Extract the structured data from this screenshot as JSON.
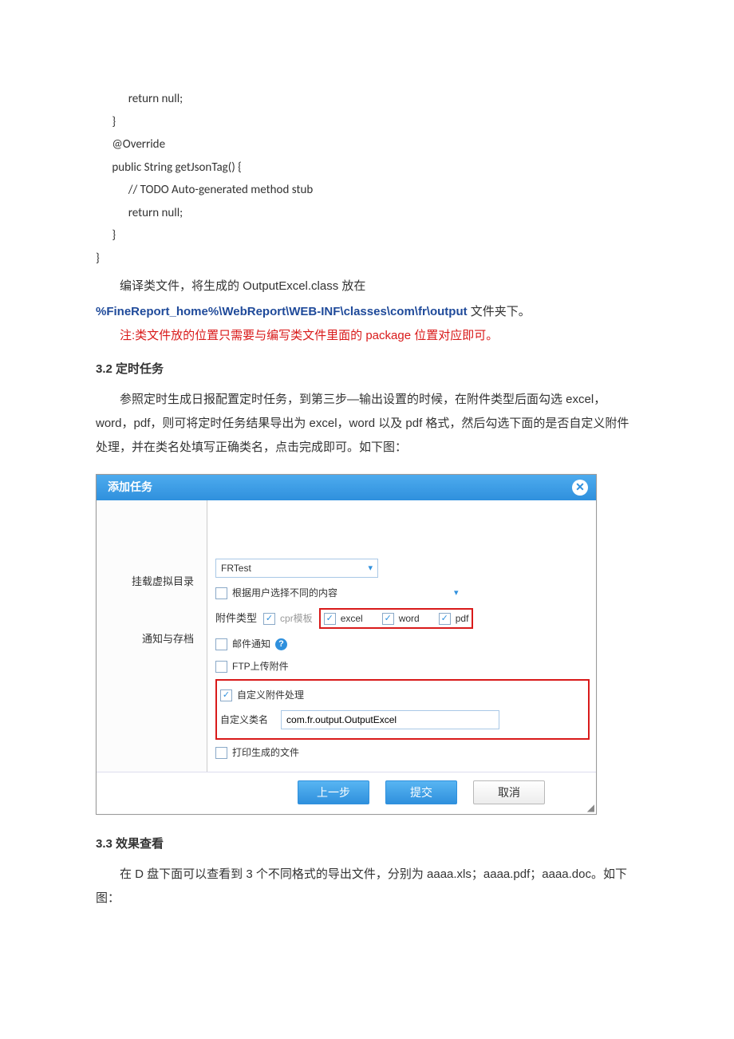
{
  "code": "            return null;\n      }\n      @Override\n      public String getJsonTag() {\n            // TODO Auto-generated method stub\n            return null;\n      }\n}",
  "text": {
    "p1_prefix": "编译类文件，将生成的 OutputExcel.class 放在",
    "path": "%FineReport_home%\\WebReport\\WEB-INF\\classes\\com\\fr\\output",
    "p1_suffix": "文件夹下。",
    "note": "注:类文件放的位置只需要与编写类文件里面的 package 位置对应即可。",
    "h1": "3.2 定时任务",
    "p2": "参照定时生成日报配置定时任务，到第三步—输出设置的时候，在附件类型后面勾选 excel，word，pdf，则可将定时任务结果导出为 excel，word 以及 pdf 格式，然后勾选下面的是否自定义附件处理，并在类名处填写正确类名，点击完成即可。如下图：",
    "h2": "3.3  效果查看",
    "p3": "在 D 盘下面可以查看到 3 个不同格式的导出文件，分别为 aaaa.xls；aaaa.pdf；aaaa.doc。如下图："
  },
  "dialog": {
    "title": "添加任务",
    "leftLabels": {
      "vdir": "挂载虚拟目录",
      "notify": "通知与存档"
    },
    "combo_value": "FRTest",
    "cb_userchoose": "根据用户选择不同的内容",
    "attach_label": "附件类型",
    "cb_cpr": "cpr模板",
    "cb_excel": "excel",
    "cb_word": "word",
    "cb_pdf": "pdf",
    "cb_mail": "邮件通知",
    "cb_ftp": "FTP上传附件",
    "cb_custom": "自定义附件处理",
    "custom_label": "自定义类名",
    "custom_value": "com.fr.output.OutputExcel",
    "cb_print": "打印生成的文件",
    "btn_prev": "上一步",
    "btn_submit": "提交",
    "btn_cancel": "取消"
  }
}
